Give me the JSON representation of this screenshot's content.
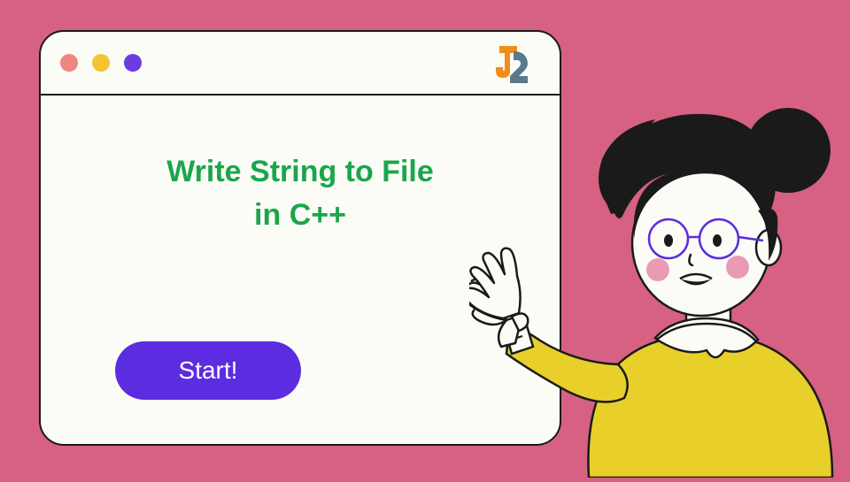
{
  "window": {
    "title_line1": "Write String to File",
    "title_line2": "in C++",
    "start_label": "Start!",
    "logo": {
      "j_color": "#f28c1a",
      "two_color": "#5a7a8c"
    },
    "dots": {
      "red": "#ef8583",
      "yellow": "#f5c431",
      "purple": "#6c3ce0"
    }
  },
  "character": {
    "shirt_color": "#e8cf2a",
    "hair_color": "#1a1a1a",
    "skin_color": "#fcfcf7",
    "blush_color": "#e99bb5",
    "glasses_color": "#5b2ce0"
  }
}
